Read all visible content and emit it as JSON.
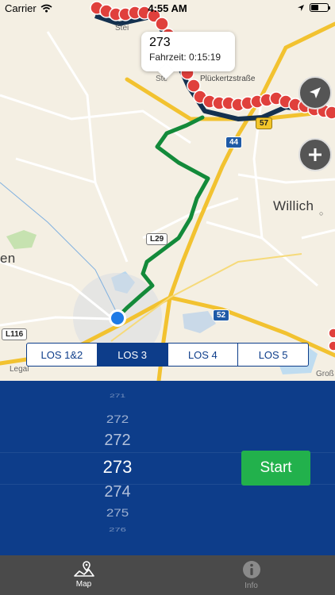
{
  "status_bar": {
    "carrier": "Carrier",
    "time": "4:55 AM"
  },
  "map": {
    "callout": {
      "title": "273",
      "subtitle": "Fahrzeit: 0:15:19"
    },
    "labels": {
      "willich": "Willich",
      "en": "en",
      "street_top": "Stei",
      "street_plucker": "Plückertzstraße",
      "stei2": "Ste",
      "legal": "Legal",
      "gross": "Groß"
    },
    "shields": {
      "a44": "44",
      "l29": "L29",
      "a52": "52",
      "l116": "L116",
      "a57": "57"
    },
    "route_color": "#138a3a",
    "line_color": "#e0403c"
  },
  "los_tabs": [
    {
      "label": "LOS 1&2",
      "active": false
    },
    {
      "label": "LOS 3",
      "active": true
    },
    {
      "label": "LOS 4",
      "active": false
    },
    {
      "label": "LOS 5",
      "active": false
    }
  ],
  "picker": {
    "above": [
      "271",
      "272",
      "272"
    ],
    "selected": "273",
    "below": [
      "274",
      "275",
      "276"
    ]
  },
  "start_button": "Start",
  "tabs": [
    {
      "label": "Map",
      "icon": "map-icon",
      "active": true
    },
    {
      "label": "Info",
      "icon": "info-icon",
      "active": false
    }
  ],
  "colors": {
    "panel": "#0d3d8a",
    "start": "#22b14c",
    "tabbar": "#4a4a4a"
  }
}
